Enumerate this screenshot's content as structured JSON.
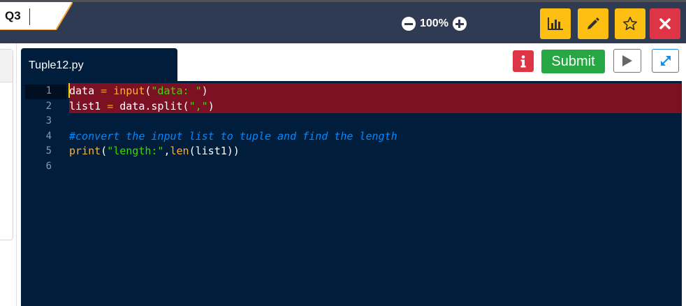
{
  "header": {
    "question_label": "Q3",
    "zoom_level": "100%",
    "buttons": [
      {
        "name": "stats",
        "icon": "bar-chart-icon"
      },
      {
        "name": "edit",
        "icon": "pencil-icon"
      },
      {
        "name": "bookmark",
        "icon": "star-icon"
      },
      {
        "name": "close",
        "icon": "close-icon"
      }
    ]
  },
  "editor": {
    "filename": "Tuple12.py",
    "submit_label": "Submit",
    "lines": [
      {
        "num": "1",
        "tokens": [
          {
            "t": "data ",
            "c": ""
          },
          {
            "t": "=",
            "c": "op"
          },
          {
            "t": " ",
            "c": ""
          },
          {
            "t": "input",
            "c": "kw"
          },
          {
            "t": "(",
            "c": ""
          },
          {
            "t": "\"data: \"",
            "c": "str"
          },
          {
            "t": ")",
            "c": ""
          }
        ]
      },
      {
        "num": "2",
        "tokens": [
          {
            "t": "list1 ",
            "c": ""
          },
          {
            "t": "=",
            "c": "op"
          },
          {
            "t": " data.split(",
            "c": ""
          },
          {
            "t": "\",\"",
            "c": "str"
          },
          {
            "t": ")",
            "c": ""
          }
        ]
      },
      {
        "num": "3",
        "tokens": []
      },
      {
        "num": "4",
        "tokens": [
          {
            "t": "#convert the input list to tuple and find the length",
            "c": "cm"
          }
        ]
      },
      {
        "num": "5",
        "tokens": [
          {
            "t": "print",
            "c": "kw"
          },
          {
            "t": "(",
            "c": ""
          },
          {
            "t": "\"length:\"",
            "c": "str"
          },
          {
            "t": ",",
            "c": ""
          },
          {
            "t": "len",
            "c": "kw"
          },
          {
            "t": "(list1))",
            "c": ""
          }
        ]
      },
      {
        "num": "6",
        "tokens": []
      }
    ]
  },
  "colors": {
    "topbar": "#2e3b53",
    "accent_yellow": "#fdbf12",
    "danger_red": "#dd3545",
    "submit_green": "#27a744",
    "editor_bg": "#001e3c",
    "selection": "#7c1123"
  }
}
